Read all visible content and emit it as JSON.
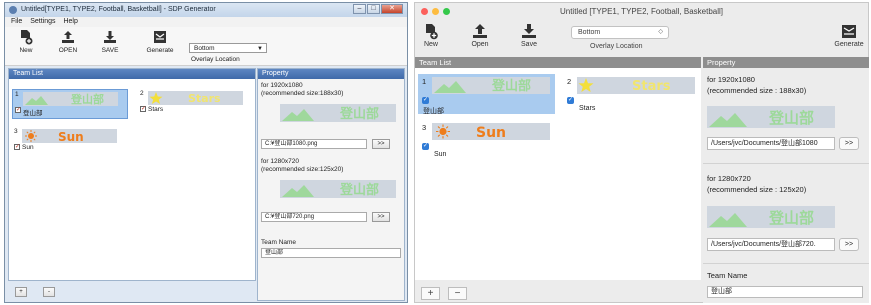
{
  "windows_app": {
    "title": "Untitled[TYPE1, TYPE2, Football, Basketball] - SDP Generator",
    "controls": {
      "min": "–",
      "max": "□",
      "close": "✕"
    },
    "menu": [
      "File",
      "Settings",
      "Help"
    ],
    "toolbar": {
      "new": "New",
      "open": "OPEN",
      "save": "SAVE",
      "generate": "Generate"
    },
    "overlay_select": "Bottom",
    "overlay_label": "Overlay Location",
    "team_list_header": "Team List",
    "property_header": "Property",
    "teams": [
      {
        "num": "1",
        "name": "登山部",
        "banner_text": "登山部",
        "checked": "✓"
      },
      {
        "num": "2",
        "name": "Stars",
        "banner_text": "Stars",
        "checked": "✓"
      },
      {
        "num": "3",
        "name": "Sun",
        "banner_text": "Sun",
        "checked": "✓"
      }
    ],
    "property": {
      "sec1_line1": "for 1920x1080",
      "sec1_line2": "(recommended size:188x30)",
      "sec1_path": "C:¥登山部1080.png",
      "sec2_line1": "for 1280x720",
      "sec2_line2": "(recommended size:125x20)",
      "sec2_path": "C:¥登山部720.png",
      "browse": ">>",
      "team_name_label": "Team Name",
      "team_name_value": "登山部",
      "banner_text": "登山部"
    },
    "add": "+",
    "remove": "-"
  },
  "mac_app": {
    "title": "Untitled  [TYPE1, TYPE2, Football, Basketball]",
    "toolbar": {
      "new": "New",
      "open": "Open",
      "save": "Save",
      "generate": "Generate"
    },
    "overlay_select": "Bottom",
    "overlay_label": "Overlay Location",
    "team_list_header": "Team List",
    "property_header": "Property",
    "teams": [
      {
        "num": "1",
        "name": "登山部",
        "banner_text": "登山部",
        "checked": "✓"
      },
      {
        "num": "2",
        "name": "Stars",
        "banner_text": "Stars",
        "checked": "✓"
      },
      {
        "num": "3",
        "name": "Sun",
        "banner_text": "Sun",
        "checked": "✓"
      }
    ],
    "property": {
      "sec1_line1": "for 1920x1080",
      "sec1_line2": "(recommended size : 188x30)",
      "sec1_path": "/Users/jvc/Documents/登山部1080",
      "sec2_line1": "for 1280x720",
      "sec2_line2": "(recommended size : 125x20)",
      "sec2_path": "/Users/jvc/Documents/登山部720.",
      "browse": ">>",
      "team_name_label": "Team Name",
      "team_name_value": "登山部",
      "banner_text": "登山部"
    },
    "add": "+",
    "remove": "−"
  },
  "colors": {
    "win_header": "#4b76b5",
    "selected_row": "#a9cbef",
    "mac_header": "#8e8e8e",
    "mac_checkbox": "#2f7bd6",
    "banner_green": "#9dd99a",
    "banner_yellow": "#f1e56e",
    "banner_orange": "#ee7d1c"
  },
  "icons": [
    "new-file-icon",
    "upload-icon",
    "download-icon",
    "generate-icon",
    "mountain-icon",
    "star-icon",
    "sun-icon"
  ]
}
